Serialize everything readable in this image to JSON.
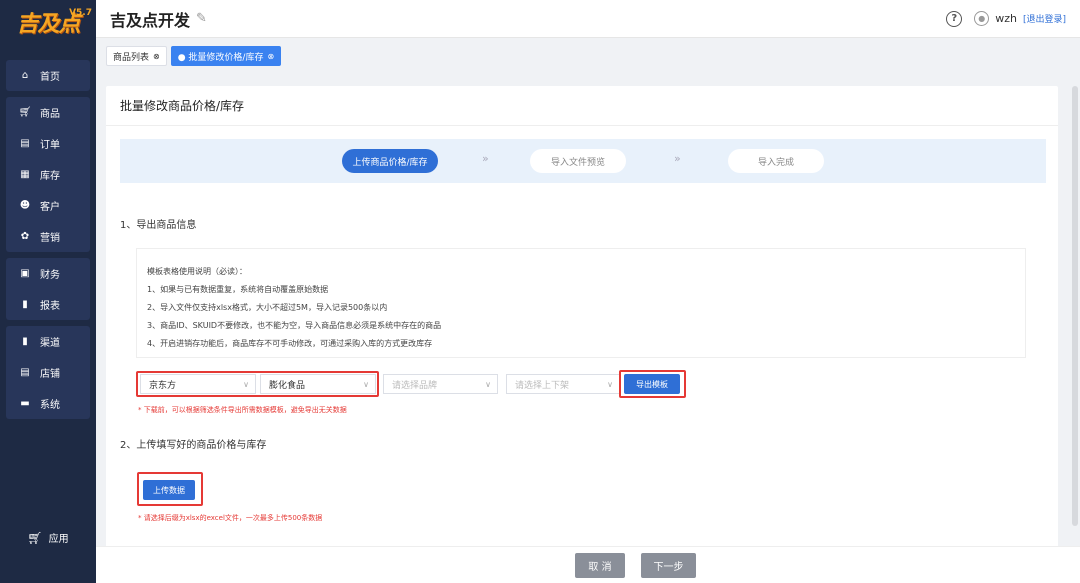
{
  "app": {
    "logo_text": "吉及点",
    "version": "V5.7"
  },
  "sidebar": {
    "groups": [
      [
        {
          "label": "首页",
          "icon": "home-icon"
        }
      ],
      [
        {
          "label": "商品",
          "icon": "cart-icon"
        },
        {
          "label": "订单",
          "icon": "order-icon"
        },
        {
          "label": "库存",
          "icon": "grid-icon"
        },
        {
          "label": "客户",
          "icon": "users-icon"
        },
        {
          "label": "营销",
          "icon": "gear-icon"
        }
      ],
      [
        {
          "label": "财务",
          "icon": "wallet-icon"
        },
        {
          "label": "报表",
          "icon": "chart-icon"
        }
      ],
      [
        {
          "label": "渠道",
          "icon": "chart-icon"
        },
        {
          "label": "店铺",
          "icon": "store-icon"
        },
        {
          "label": "系统",
          "icon": "monitor-icon"
        }
      ]
    ],
    "app_label": "应用"
  },
  "header": {
    "title": "吉及点开发",
    "username": "wzh",
    "logout": "[退出登录]"
  },
  "tabs": [
    {
      "label": "商品列表"
    },
    {
      "label": "● 批量修改价格/库存"
    }
  ],
  "card": {
    "title": "批量修改商品价格/库存",
    "steps": [
      "上传商品价格/库存",
      "导入文件预览",
      "导入完成"
    ],
    "section1": "1、导出商品信息",
    "notice": [
      "模板表格使用说明（必读）：",
      "1、如果与已有数据重复，系统将自动覆盖原始数据",
      "2、导入文件仅支持xlsx格式，大小不超过5M，导入记录500条以内",
      "3、商品ID、SKUID不要修改，也不能为空，导入商品信息必须是系统中存在的商品",
      "4、开启进销存功能后，商品库存不可手动修改，可通过采购入库的方式更改库存"
    ],
    "filters": {
      "platform": "京东方",
      "category": "膨化食品",
      "brand_placeholder": "请选择品牌",
      "shelf_placeholder": "请选择上下架"
    },
    "export_button": "导出模板",
    "export_hint": "* 下载前，可以根据筛选条件导出所需数据模板，避免导出无关数据",
    "section2": "2、上传填写好的商品价格与库存",
    "upload_button": "上传数据",
    "upload_hint": "* 请选择后缀为xlsx的excel文件，一次最多上传500条数据"
  },
  "footer": {
    "cancel": "取 消",
    "next": "下一步"
  }
}
